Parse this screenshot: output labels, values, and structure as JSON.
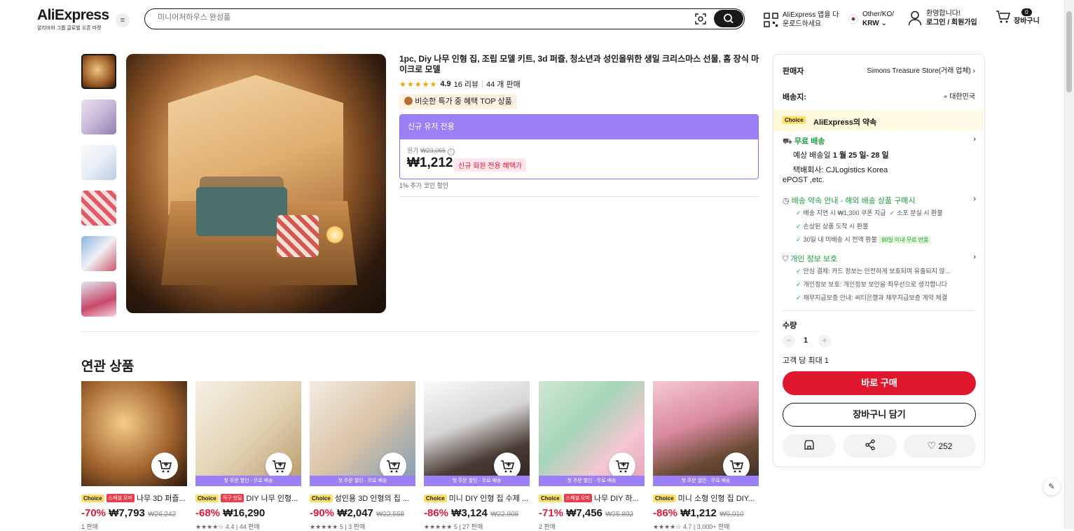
{
  "header": {
    "logo": "AliExpress",
    "logo_sub": "알리바바 그룹 글로벌 오픈 마켓",
    "search_placeholder": "미니어처하우스 완성품",
    "app_line1": "AliExpress 앱을 다",
    "app_line2": "운로드하세요",
    "region_line1": "Other/KO/",
    "region_line2": "KRW",
    "user_line1": "환영합니다!",
    "user_line2": "로그인 / 회원가입",
    "cart_count": "0",
    "cart_label": "장바구니"
  },
  "product": {
    "title": "1pc, Diy 나무 인형 집, 조립 모델 키트, 3d 퍼즐, 청소년과 성인을위한 생일 크리스마스 선물, 홈 장식 마이크로 모델",
    "stars": "★★★★★",
    "rating": "4.9",
    "reviews": "16 리뷰",
    "sold": "44 개 판매",
    "top_badge": "비슷한 특가 중 혜택 TOP 상품",
    "promo_header": "신규 유저 전용",
    "original_label": "원가",
    "original_price": "₩23,065",
    "price": "₩1,212",
    "price_tag": "신규 회원 전용 혜택가",
    "coin_discount": "1% 추가 코인 할인"
  },
  "related": {
    "title": "연관 상품",
    "items": [
      {
        "tag": "스페셜 오퍼",
        "name": "나무 3D 퍼즐...",
        "discount": "-70%",
        "price": "₩7,793",
        "orig": "₩26,242",
        "sold": "1 판매",
        "strip": ""
      },
      {
        "tag": "직구 핫딜",
        "name": "DIY 나무 인형...",
        "discount": "-68%",
        "price": "₩16,290",
        "orig": "",
        "sold": "★★★★☆ 4.4 | 44 판매",
        "strip": "첫 주문 할인 · 무료 배송"
      },
      {
        "tag": "",
        "name": "성인용 3D 인형의 집 ...",
        "discount": "-90%",
        "price": "₩2,047",
        "orig": "₩22,558",
        "sold": "★★★★★ 5 | 3 판매",
        "strip": "첫 주문 할인 · 무료 배송"
      },
      {
        "tag": "",
        "name": "미니 DIY 인형 집 수제 ...",
        "discount": "-86%",
        "price": "₩3,124",
        "orig": "₩22,908",
        "sold": "★★★★★ 5 | 27 판매",
        "strip": "첫 주문 할인 · 무료 배송"
      },
      {
        "tag": "스페셜 오퍼",
        "name": "나무 DIY 하...",
        "discount": "-71%",
        "price": "₩7,456",
        "orig": "₩25,892",
        "sold": "2 판매",
        "strip": "첫 주문 할인 · 무료 배송"
      },
      {
        "tag": "",
        "name": "미니 소형 인형 집 DIY...",
        "discount": "-86%",
        "price": "₩1,212",
        "orig": "₩9,010",
        "sold": "★★★★☆ 4.7 | 3,000+ 판매",
        "strip": "첫 주문 할인 · 무료 배송"
      }
    ],
    "choice_label": "Choice"
  },
  "panel": {
    "seller_label": "판매자",
    "seller_name": "Simons Treasure Store(거래 업체)",
    "ship_label": "배송지:",
    "ship_to": "대한민국",
    "choice_label": "Choice",
    "promise": "AliExpress의 약속",
    "free_ship": "무료 배송",
    "eta_prefix": "예상 배송일",
    "eta": "1 월 25 일- 28 일",
    "carrier_line1": "택배회사:  CJLogistics  Korea",
    "carrier_line2": "ePOST ,etc.",
    "ship_guide": "배송 약속 안내 - 해외 배송 상품 구매시",
    "g1": "배송 지연 시 ₩1,300 쿠폰 지급",
    "g2": "소포 분실 시 환불",
    "g3": "손상된 상품 도착 시 환불",
    "g4": "30일 내 미배송 시 전액 환불",
    "g4_pill": "90일 이내 무료 반품",
    "privacy": "개인 정보 보호",
    "p1": "안심 결제: 카드 정보는 안전하게 보호되며 유출되지 않...",
    "p2": "개인정보 보호: 개인정보 보안을 최우선으로 생각합니다",
    "p3": "채무지급보증 안내: 씨티은행과 채무지급보증 계약 체결",
    "qty_label": "수량",
    "qty": "1",
    "max_per": "고객 당 최대 1",
    "buy_now": "바로 구매",
    "add_cart": "장바구니 담기",
    "likes": "252"
  },
  "colors": {
    "accent_red": "#e0182d",
    "promo_purple": "#9c80f7",
    "benefit_green": "#1a9f3e"
  }
}
